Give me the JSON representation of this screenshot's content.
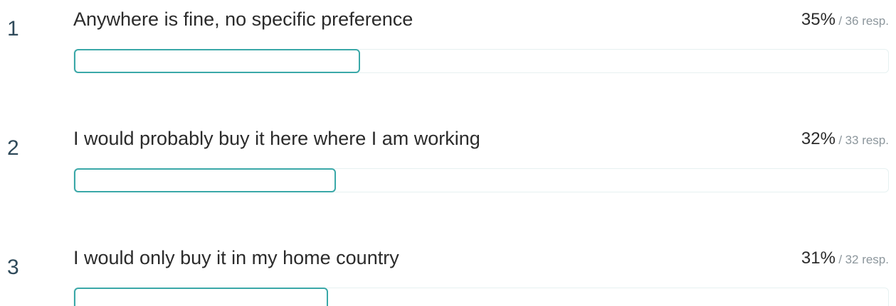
{
  "chart_data": {
    "type": "bar",
    "categories": [
      "Anywhere is fine, no specific preference",
      "I would probably buy it here where I am working",
      "I would only buy it in my home country"
    ],
    "values": [
      35,
      32,
      31
    ],
    "responses": [
      36,
      33,
      32
    ],
    "ranks": [
      "1",
      "2",
      "3"
    ],
    "percent_labels": [
      "35%",
      "32%",
      "31%"
    ],
    "response_labels": [
      "36 resp.",
      "33 resp.",
      "32 resp."
    ],
    "separator": "/",
    "xlim": [
      0,
      100
    ],
    "bar_color": "#3aa8a8",
    "track_color": "#e6f1f1"
  }
}
